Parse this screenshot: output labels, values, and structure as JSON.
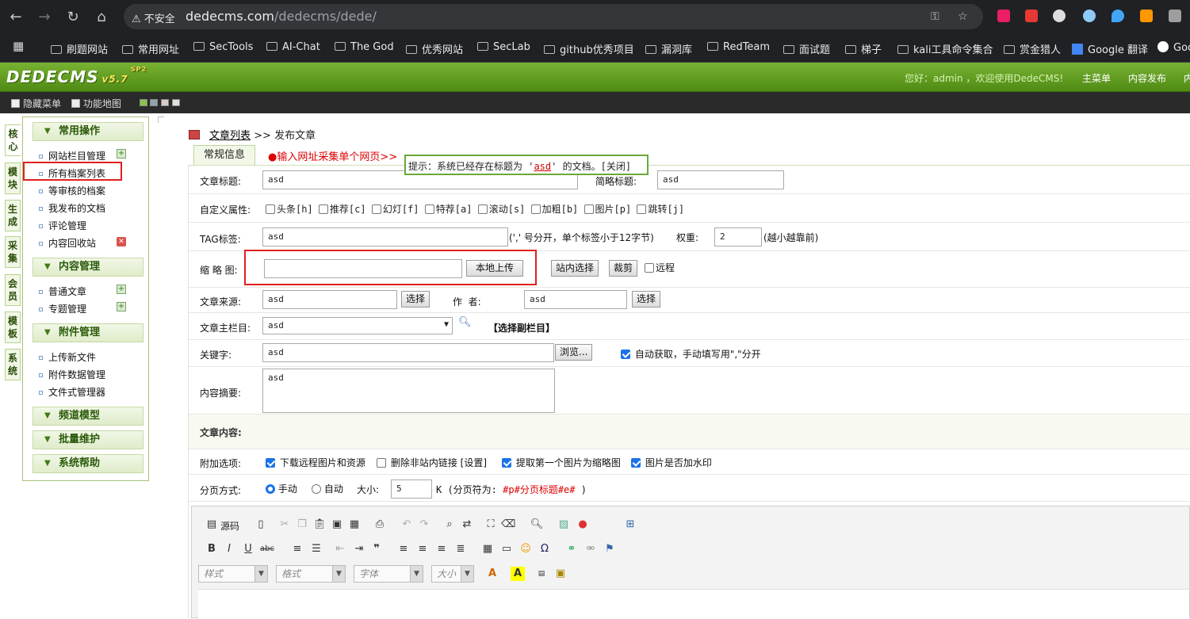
{
  "browser": {
    "security_label": "不安全",
    "url_host": "dedecms.com",
    "url_path": "/dedecms/dede/",
    "bookmarks": [
      "刷题网站",
      "常用网址",
      "SecTools",
      "AI-Chat",
      "The God",
      "优秀网站",
      "SecLab",
      "github优秀项目",
      "漏洞库",
      "RedTeam",
      "面试题",
      "梯子",
      "kali工具命令集合",
      "赏金猎人",
      "Google 翻译",
      "Goo"
    ]
  },
  "header": {
    "logo": "DEDECMS",
    "version": "v5.7",
    "version_sup": "SP2",
    "welcome": "您好：admin ，欢迎使用DedeCMS!",
    "nav": [
      "主菜单",
      "内容发布",
      "内"
    ]
  },
  "toolbar": {
    "hide_menu": "隐藏菜单",
    "feature_map": "功能地图"
  },
  "left_tabs": [
    "核心",
    "模块",
    "生成",
    "采集",
    "会员",
    "模板",
    "系统"
  ],
  "menu": {
    "groups": [
      {
        "title": "常用操作",
        "items": [
          "网站栏目管理",
          "所有档案列表",
          "等审核的档案",
          "我发布的文档",
          "评论管理",
          "内容回收站"
        ]
      },
      {
        "title": "内容管理",
        "items": [
          "普通文章",
          "专题管理"
        ]
      },
      {
        "title": "附件管理",
        "items": [
          "上传新文件",
          "附件数据管理",
          "文件式管理器"
        ]
      },
      {
        "title": "频道模型",
        "items": []
      },
      {
        "title": "批量维护",
        "items": []
      },
      {
        "title": "系统帮助",
        "items": []
      }
    ]
  },
  "crumb": {
    "list": "文章列表",
    "sep": ">>",
    "current": "发布文章"
  },
  "tabs": {
    "general": "常规信息",
    "collect": "●输入网址采集单个网页>>"
  },
  "tip": {
    "prefix": "提示：系统已经存在标题为 '",
    "title": "asd",
    "suffix": "' 的文档。[关闭]"
  },
  "form": {
    "title_label": "文章标题:",
    "title_value": "asd",
    "short_title_label": "简略标题:",
    "short_title_value": "asd",
    "attr_label": "自定义属性:",
    "attrs": [
      "头条[h]",
      "推荐[c]",
      "幻灯[f]",
      "特荐[a]",
      "滚动[s]",
      "加粗[b]",
      "图片[p]",
      "跳转[j]"
    ],
    "tag_label": "TAG标签:",
    "tag_value": "asd",
    "tag_hint": "(',' 号分开，单个标签小于12字节)",
    "weight_label": "权重:",
    "weight_value": "2",
    "weight_hint": "(越小越靠前)",
    "thumb_label": "缩 略 图:",
    "thumb_value": "",
    "upload_btn": "本地上传",
    "site_select_btn": "站内选择",
    "crop_btn": "裁剪",
    "remote_label": "远程",
    "source_label": "文章来源:",
    "source_value": "asd",
    "select_btn": "选择",
    "author_label": "作  者:",
    "author_value": "asd",
    "author_select_btn": "选择",
    "category_label": "文章主栏目:",
    "category_value": "asd",
    "sub_category": "【选择副栏目】",
    "keywords_label": "关键字:",
    "keywords_value": "asd",
    "browse_btn": "浏览...",
    "auto_kw": "自动获取，手动填写用\",\"分开",
    "summary_label": "内容摘要:",
    "summary_value": "asd",
    "content_label": "文章内容:",
    "extra_label": "附加选项:",
    "extras": [
      {
        "label": "下载远程图片和资源",
        "checked": true
      },
      {
        "label": "删除非站内链接",
        "checked": false,
        "link": "[设置]"
      },
      {
        "label": "提取第一个图片为缩略图",
        "checked": true
      },
      {
        "label": "图片是否加水印",
        "checked": true
      }
    ],
    "paging_label": "分页方式:",
    "paging_manual": "手动",
    "paging_auto": "自动",
    "size_label": "大小:",
    "size_value": "5",
    "paging_hint_prefix": "K (分页符为:",
    "paging_hint_code": "#p#分页标题#e#",
    "paging_hint_suffix": ")"
  },
  "editor": {
    "source": "源码",
    "style": "样式",
    "format": "格式",
    "font": "字体",
    "size": "大小"
  }
}
